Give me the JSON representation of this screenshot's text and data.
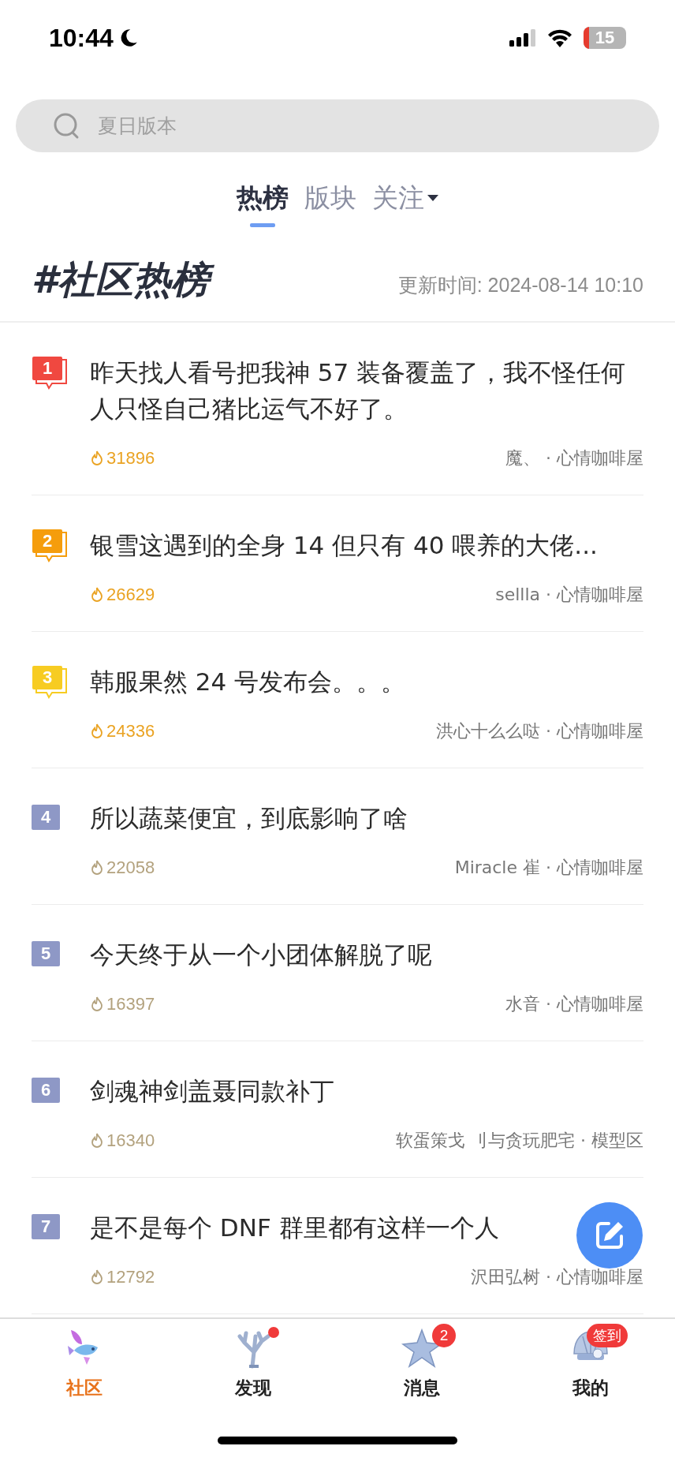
{
  "status_bar": {
    "time": "10:44",
    "battery": "15"
  },
  "search": {
    "placeholder": "夏日版本"
  },
  "tabs": [
    {
      "label": "热榜",
      "selected": true,
      "dropdown": false
    },
    {
      "label": "版块",
      "selected": false,
      "dropdown": false
    },
    {
      "label": "关注",
      "selected": false,
      "dropdown": true
    }
  ],
  "header": {
    "title": "#社区热榜",
    "updated": "更新时间: 2024-08-14 10:10"
  },
  "posts": [
    {
      "rank": "1",
      "kind": "top",
      "color": "#f04840",
      "title": "昨天找人看号把我神 57 装备覆盖了，我不怪任何人只怪自己猪比运气不好了。",
      "heat": "31896",
      "meta": "魔、 · 心情咖啡屋"
    },
    {
      "rank": "2",
      "kind": "top",
      "color": "#f59d0c",
      "title": "银雪这遇到的全身 14 但只有 40 喂养的大佬...",
      "heat": "26629",
      "meta": "sellla · 心情咖啡屋"
    },
    {
      "rank": "3",
      "kind": "top",
      "color": "#f7cc22",
      "title": "韩服果然 24 号发布会。。。",
      "heat": "24336",
      "meta": "洪心十么么哒 · 心情咖啡屋"
    },
    {
      "rank": "4",
      "kind": "plain",
      "color": "#8e98c6",
      "title": "所以蔬菜便宜，到底影响了啥",
      "heat": "22058",
      "meta": "Miracle 崔 · 心情咖啡屋"
    },
    {
      "rank": "5",
      "kind": "plain",
      "color": "#8e98c6",
      "title": "今天终于从一个小团体解脱了呢",
      "heat": "16397",
      "meta": "水音 · 心情咖啡屋"
    },
    {
      "rank": "6",
      "kind": "plain",
      "color": "#8e98c6",
      "title": "剑魂神剑盖聂同款补丁",
      "heat": "16340",
      "meta": "软蛋策戈 刂与贪玩肥宅 · 模型区"
    },
    {
      "rank": "7",
      "kind": "plain",
      "color": "#8e98c6",
      "title": "是不是每个 DNF 群里都有这样一个人",
      "heat": "12792",
      "meta": "沢田弘树 · 心情咖啡屋"
    }
  ],
  "nav": [
    {
      "label": "社区",
      "selected": true
    },
    {
      "label": "发现",
      "selected": false,
      "badge": {
        "kind": "dot"
      }
    },
    {
      "label": "消息",
      "selected": false,
      "badge": {
        "kind": "count",
        "text": "2"
      }
    },
    {
      "label": "我的",
      "selected": false,
      "badge": {
        "kind": "label",
        "text": "签到"
      }
    }
  ]
}
